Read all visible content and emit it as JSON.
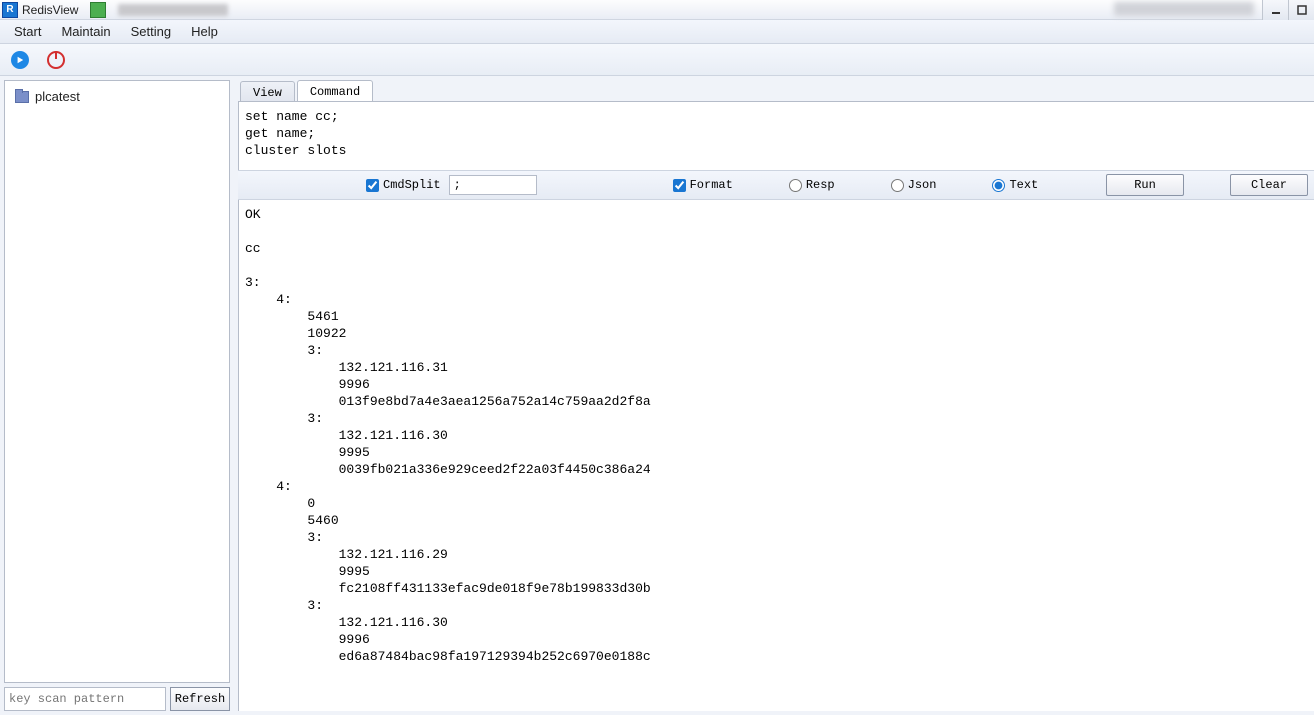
{
  "titlebar": {
    "app_name": "RedisView"
  },
  "menu": {
    "start": "Start",
    "maintain": "Maintain",
    "setting": "Setting",
    "help": "Help"
  },
  "sidebar": {
    "tree": {
      "items": [
        {
          "label": "plcatest"
        }
      ]
    },
    "pattern_placeholder": "key scan pattern",
    "refresh_label": "Refresh"
  },
  "tabs": {
    "view": "View",
    "command": "Command",
    "active": "command"
  },
  "command_input": "set name cc;\nget name;\ncluster slots",
  "controls": {
    "cmdsplit_label": "CmdSplit",
    "cmdsplit_checked": true,
    "split_value": ";",
    "format_label": "Format",
    "format_checked": true,
    "resp_label": "Resp",
    "json_label": "Json",
    "text_label": "Text",
    "mode": "text",
    "run_label": "Run",
    "clear_label": "Clear"
  },
  "output_text": "OK\n\ncc\n\n3:\n    4:\n        5461\n        10922\n        3:\n            132.121.116.31\n            9996\n            013f9e8bd7a4e3aea1256a752a14c759aa2d2f8a\n        3:\n            132.121.116.30\n            9995\n            0039fb021a336e929ceed2f22a03f4450c386a24\n    4:\n        0\n        5460\n        3:\n            132.121.116.29\n            9995\n            fc2108ff431133efac9de018f9e78b199833d30b\n        3:\n            132.121.116.30\n            9996\n            ed6a87484bac98fa197129394b252c6970e0188c"
}
